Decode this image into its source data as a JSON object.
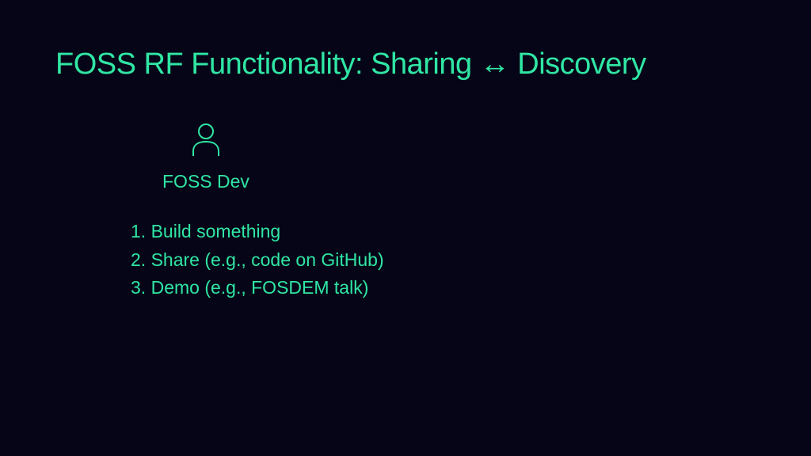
{
  "title": "FOSS RF Functionality: Sharing ↔ Discovery",
  "persona": {
    "label": "FOSS Dev"
  },
  "steps": {
    "item1": "Build something",
    "item2": "Share (e.g., code on GitHub)",
    "item3": "Demo (e.g., FOSDEM talk)"
  },
  "colors": {
    "background": "#050517",
    "accent": "#30e6a4"
  }
}
